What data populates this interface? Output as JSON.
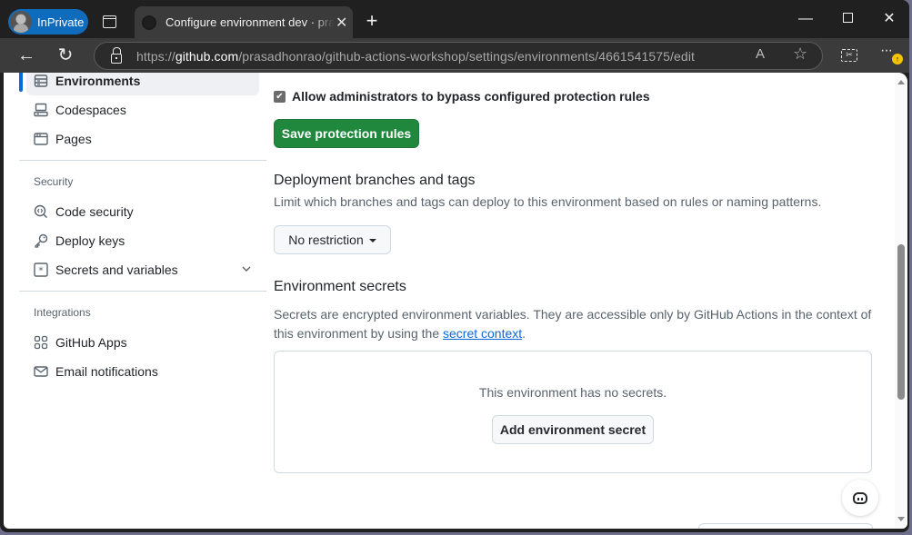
{
  "browser": {
    "profile_label": "InPrivate",
    "tab": {
      "title": "Configure environment dev · prasadhonrao/github-actions-workshop"
    },
    "new_tab_label": "+",
    "window_controls": {
      "minimize": "—",
      "close": "✕"
    },
    "address": {
      "scheme": "https://",
      "host": "github.com",
      "path": "/prasadhonrao/github-actions-workshop/settings/environments/4661541575/edit"
    },
    "icons": {
      "back": "←",
      "refresh": "↻",
      "read_aloud": "A",
      "favorite": "☆",
      "more": "···",
      "update_badge": "↑"
    }
  },
  "sidebar": {
    "top_items": [
      {
        "label": "Environments",
        "icon": "server-icon",
        "active": true
      },
      {
        "label": "Codespaces",
        "icon": "codespaces-icon",
        "active": false
      },
      {
        "label": "Pages",
        "icon": "browser-icon",
        "active": false
      }
    ],
    "groups": [
      {
        "label": "Security",
        "items": [
          {
            "label": "Code security",
            "icon": "codescan-icon"
          },
          {
            "label": "Deploy keys",
            "icon": "key-icon"
          },
          {
            "label": "Secrets and variables",
            "icon": "asterisk-icon",
            "expandable": true
          }
        ]
      },
      {
        "label": "Integrations",
        "items": [
          {
            "label": "GitHub Apps",
            "icon": "apps-icon"
          },
          {
            "label": "Email notifications",
            "icon": "mail-icon"
          }
        ]
      }
    ]
  },
  "main": {
    "bypass_checkbox": {
      "label": "Allow administrators to bypass configured protection rules",
      "checked": true
    },
    "save_button": "Save protection rules",
    "deployment": {
      "title": "Deployment branches and tags",
      "description": "Limit which branches and tags can deploy to this environment based on rules or naming patterns.",
      "dropdown_value": "No restriction"
    },
    "secrets": {
      "title": "Environment secrets",
      "description_prefix": "Secrets are encrypted environment variables. They are accessible only by GitHub Actions in the context of this environment by using the ",
      "link_text": "secret context",
      "description_suffix": ".",
      "empty_message": "This environment has no secrets.",
      "add_button": "Add environment secret"
    }
  },
  "colors": {
    "primary_green": "#1f883d",
    "accent_blue": "#0969da",
    "inprivate_blue": "#0f6cbd"
  }
}
